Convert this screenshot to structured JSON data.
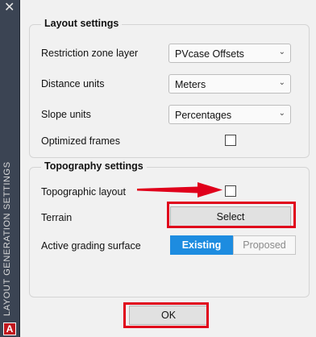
{
  "sidebar": {
    "title": "LAYOUT GENERATION SETTINGS",
    "logo_letter": "A"
  },
  "layout": {
    "title": "Layout settings",
    "restriction_zone_label": "Restriction zone layer",
    "restriction_zone_value": "PVcase Offsets",
    "distance_units_label": "Distance units",
    "distance_units_value": "Meters",
    "slope_units_label": "Slope units",
    "slope_units_value": "Percentages",
    "optimized_frames_label": "Optimized frames",
    "optimized_frames_checked": false
  },
  "topography": {
    "title": "Topography settings",
    "topographic_layout_label": "Topographic layout",
    "topographic_layout_checked": false,
    "terrain_label": "Terrain",
    "select_button": "Select",
    "grading_label": "Active grading surface",
    "grading_options": [
      "Existing",
      "Proposed"
    ],
    "grading_selected": "Existing"
  },
  "footer": {
    "ok_button": "OK"
  },
  "annotations": {
    "highlight_color": "#e0001b"
  }
}
